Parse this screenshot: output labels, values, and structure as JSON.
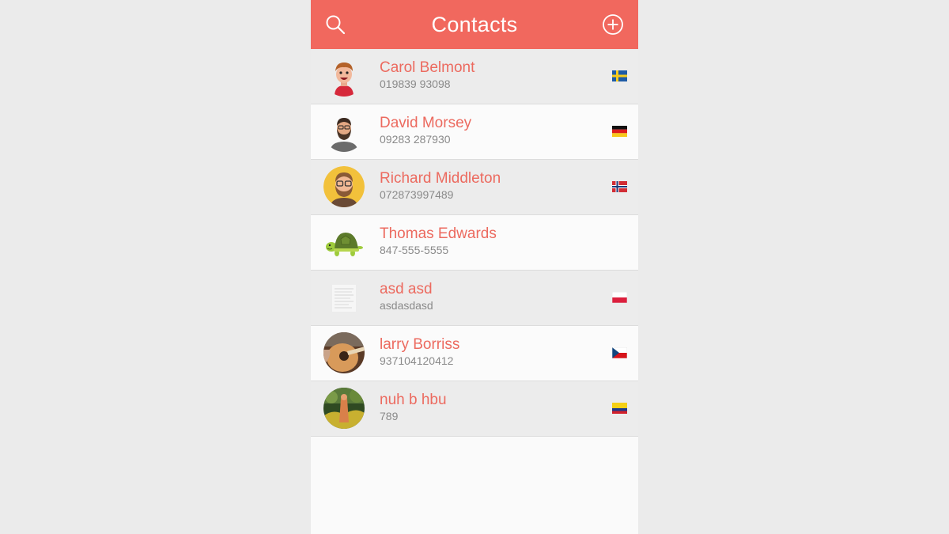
{
  "header": {
    "title": "Contacts",
    "search_icon": "search-icon",
    "add_icon": "add-circle-icon"
  },
  "colors": {
    "accent": "#f1685e",
    "name_text": "#ec6a5f",
    "number_text": "#8a8a8a",
    "background": "#ebebeb"
  },
  "contacts": [
    {
      "name": "Carol Belmont",
      "number": "019839 93098",
      "avatar": "cartoon-boy-avatar",
      "flag": "sweden-flag"
    },
    {
      "name": "David Morsey",
      "number": "09283 287930",
      "avatar": "bearded-man-avatar",
      "flag": "germany-flag"
    },
    {
      "name": "Richard Middleton",
      "number": "072873997489",
      "avatar": "glasses-man-avatar",
      "flag": "norway-flag"
    },
    {
      "name": "Thomas Edwards",
      "number": "847-555-5555",
      "avatar": "turtle-avatar",
      "flag": ""
    },
    {
      "name": "asd asd",
      "number": "asdasdasd",
      "avatar": "document-thumbnail-avatar",
      "flag": "poland-flag"
    },
    {
      "name": "larry Borriss",
      "number": "937104120412",
      "avatar": "guitar-photo-avatar",
      "flag": "czech-flag"
    },
    {
      "name": "nuh b hbu",
      "number": "789",
      "avatar": "nature-photo-avatar",
      "flag": "colombia-flag"
    }
  ]
}
